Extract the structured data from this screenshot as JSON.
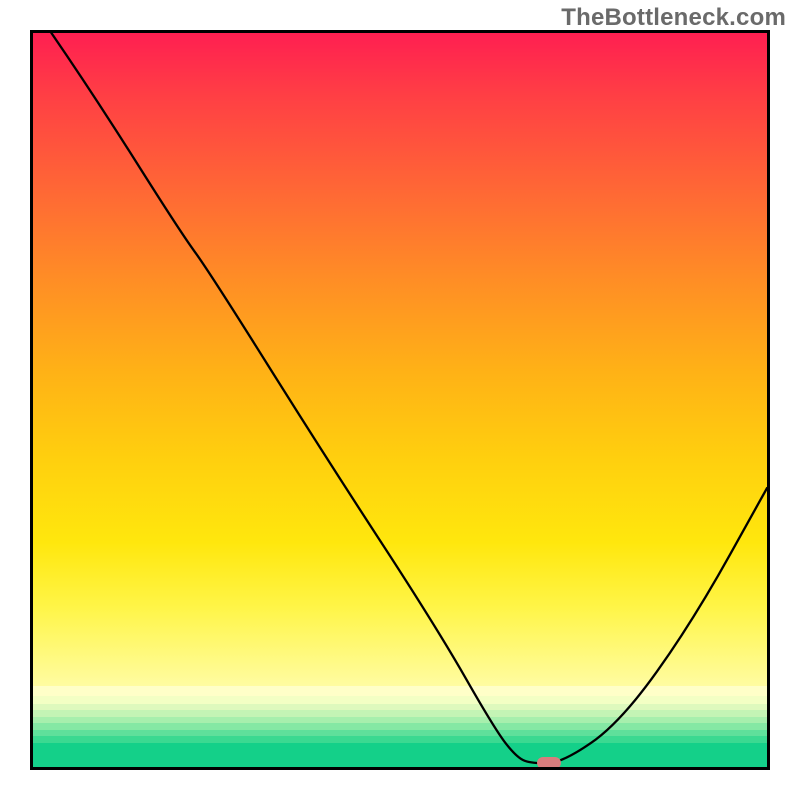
{
  "watermark": "TheBottleneck.com",
  "chart_data": {
    "type": "line",
    "title": "",
    "xlabel": "",
    "ylabel": "",
    "x_range_pct": [
      0,
      100
    ],
    "y_range_pct": [
      0,
      100
    ],
    "series": [
      {
        "name": "bottleneck-curve",
        "x_pct": [
          2.5,
          8,
          20,
          24,
          40,
          55,
          63,
          66,
          68,
          72,
          80,
          90,
          100
        ],
        "y_pct": [
          100,
          92,
          73,
          67.5,
          42,
          19,
          5,
          1.2,
          0.5,
          0.5,
          6,
          20,
          38
        ]
      }
    ],
    "marker": {
      "x_pct": 70.3,
      "y_pct": 0.5,
      "color": "#d87d7d"
    },
    "background": {
      "main_gradient_stops": [
        {
          "pct": 0,
          "color": "#ff1f51"
        },
        {
          "pct": 10,
          "color": "#ff4044"
        },
        {
          "pct": 25,
          "color": "#ff6a34"
        },
        {
          "pct": 38,
          "color": "#ff8e25"
        },
        {
          "pct": 52,
          "color": "#ffb216"
        },
        {
          "pct": 65,
          "color": "#ffcf0e"
        },
        {
          "pct": 78,
          "color": "#ffe70d"
        },
        {
          "pct": 88,
          "color": "#fff548"
        },
        {
          "pct": 100,
          "color": "#fffca1"
        }
      ],
      "lower_strips_height_pct": 11,
      "lower_strips": [
        {
          "h_pct": 12,
          "color": "#ffffc8"
        },
        {
          "h_pct": 10,
          "color": "#f3ffc4"
        },
        {
          "h_pct": 8,
          "color": "#def9bd"
        },
        {
          "h_pct": 8,
          "color": "#c4f4b5"
        },
        {
          "h_pct": 8,
          "color": "#a7efad"
        },
        {
          "h_pct": 8,
          "color": "#85e8a4"
        },
        {
          "h_pct": 8,
          "color": "#5fe09b"
        },
        {
          "h_pct": 8,
          "color": "#3bd991"
        },
        {
          "h_pct": 30,
          "color": "#14d089"
        }
      ]
    }
  }
}
